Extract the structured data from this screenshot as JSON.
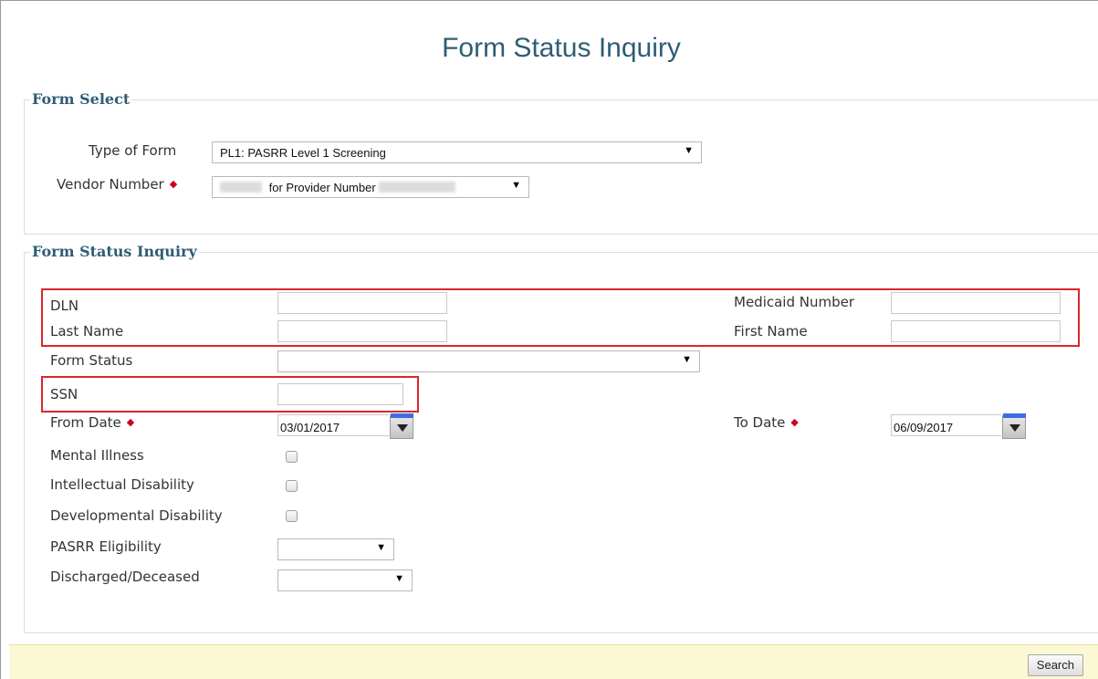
{
  "page": {
    "title": "Form Status Inquiry"
  },
  "form_select": {
    "legend": "Form Select",
    "type_of_form_label": "Type of Form",
    "type_of_form_value": "PL1: PASRR Level 1 Screening",
    "vendor_number_label": "Vendor Number",
    "vendor_number_value_text": "for Provider Number"
  },
  "inquiry": {
    "legend": "Form Status Inquiry",
    "dln_label": "DLN",
    "dln_value": "",
    "medicaid_label": "Medicaid Number",
    "medicaid_value": "",
    "last_name_label": "Last Name",
    "last_name_value": "",
    "first_name_label": "First Name",
    "first_name_value": "",
    "form_status_label": "Form Status",
    "form_status_value": "",
    "ssn_label": "SSN",
    "ssn_value": "",
    "from_date_label": "From Date",
    "from_date_value": "03/01/2017",
    "to_date_label": "To Date",
    "to_date_value": "06/09/2017",
    "mental_illness_label": "Mental Illness",
    "intellectual_label": "Intellectual Disability",
    "developmental_label": "Developmental Disability",
    "pasrr_label": "PASRR Eligibility",
    "pasrr_value": "",
    "discharged_label": "Discharged/Deceased",
    "discharged_value": ""
  },
  "footer": {
    "search_label": "Search"
  },
  "colors": {
    "heading": "#2f5d75",
    "required": "#d0021b",
    "highlight": "#d9272e",
    "footer_bg": "#fbf8d5"
  },
  "icons": {
    "dropdown": "chevron-down-icon",
    "calendar": "calendar-icon",
    "required": "required-marker-icon"
  }
}
